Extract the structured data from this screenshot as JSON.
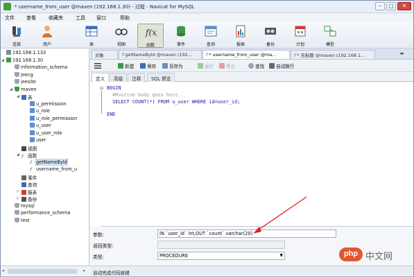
{
  "window": {
    "title": "* username_from_user @maven (192.168.1.30) - 过程 - Navicat for MySQL",
    "minimize": "–",
    "maximize": "□",
    "close": "✕"
  },
  "menu": [
    "文件",
    "查看",
    "收藏夹",
    "工具",
    "窗口",
    "帮助"
  ],
  "toolbar": [
    {
      "label": "连接",
      "icon": "plug-icon"
    },
    {
      "label": "用户",
      "icon": "user-icon"
    },
    {
      "label": "表",
      "icon": "table-icon"
    },
    {
      "label": "视图",
      "icon": "view-icon"
    },
    {
      "label": "函数",
      "icon": "function-icon"
    },
    {
      "label": "事件",
      "icon": "event-icon"
    },
    {
      "label": "查询",
      "icon": "query-icon"
    },
    {
      "label": "报表",
      "icon": "report-icon"
    },
    {
      "label": "备份",
      "icon": "backup-icon"
    },
    {
      "label": "计划",
      "icon": "schedule-icon"
    },
    {
      "label": "模型",
      "icon": "model-icon"
    }
  ],
  "tree": [
    {
      "label": "192.168.1.133",
      "level": 0,
      "icon": "connection-icon"
    },
    {
      "label": "192.168.1.30",
      "level": 0,
      "icon": "connection-open-icon"
    },
    {
      "label": "information_schema",
      "level": 1,
      "icon": "database-icon"
    },
    {
      "label": "jeecg",
      "level": 1,
      "icon": "database-icon"
    },
    {
      "label": "jeesite",
      "level": 1,
      "icon": "database-icon"
    },
    {
      "label": "maven",
      "level": 1,
      "icon": "database-open-icon"
    },
    {
      "label": "表",
      "level": 2,
      "icon": "tables-icon"
    },
    {
      "label": "u_permission",
      "level": 3,
      "icon": "table-icon"
    },
    {
      "label": "u_role",
      "level": 3,
      "icon": "table-icon"
    },
    {
      "label": "u_role_permission",
      "level": 3,
      "icon": "table-icon"
    },
    {
      "label": "u_user",
      "level": 3,
      "icon": "table-icon"
    },
    {
      "label": "u_user_role",
      "level": 3,
      "icon": "table-icon"
    },
    {
      "label": "user",
      "level": 3,
      "icon": "table-icon"
    },
    {
      "label": "视图",
      "level": 2,
      "icon": "views-icon"
    },
    {
      "label": "函数",
      "level": 2,
      "icon": "functions-icon"
    },
    {
      "label": "getNameById",
      "level": 3,
      "icon": "function-icon"
    },
    {
      "label": "username_from_u",
      "level": 3,
      "icon": "function-icon"
    },
    {
      "label": "事件",
      "level": 2,
      "icon": "events-icon"
    },
    {
      "label": "查询",
      "level": 2,
      "icon": "queries-icon"
    },
    {
      "label": "报表",
      "level": 2,
      "icon": "reports-icon"
    },
    {
      "label": "备份",
      "level": 2,
      "icon": "backups-icon"
    },
    {
      "label": "mysql",
      "level": 1,
      "icon": "database-icon"
    },
    {
      "label": "performance_schema",
      "level": 1,
      "icon": "database-icon"
    },
    {
      "label": "test",
      "level": 1,
      "icon": "database-icon"
    }
  ],
  "tabs": [
    {
      "label": "对象"
    },
    {
      "label": "getNameById @maven (192..."
    },
    {
      "label": "* username_from_user @ma..."
    },
    {
      "label": "* 无标题 @maven (192.168.1..."
    }
  ],
  "actions": {
    "new": "新建",
    "save": "保存",
    "save_as": "另存为",
    "run": "运行",
    "stop": "停止",
    "find": "查找",
    "autowrap": "自动换行"
  },
  "subtabs": [
    "定义",
    "高级",
    "注释",
    "SQL 预览"
  ],
  "code": {
    "line1": "BEGIN",
    "line2": "  #Routine body goes here...",
    "line3": "  SELECT COUNT(*) FROM u_user WHERE id=user_id;",
    "line4": "END"
  },
  "props": {
    "params_label": "参数:",
    "params_value": "IN `user_id` int,OUT `count` varchar(20)",
    "return_label": "返回类型:",
    "return_value": "",
    "type_label": "类型:",
    "type_value": "PROCEDURE"
  },
  "status": {
    "text": "自动完成代码就绪"
  },
  "watermark": {
    "logo": "php",
    "text": "中文网"
  }
}
